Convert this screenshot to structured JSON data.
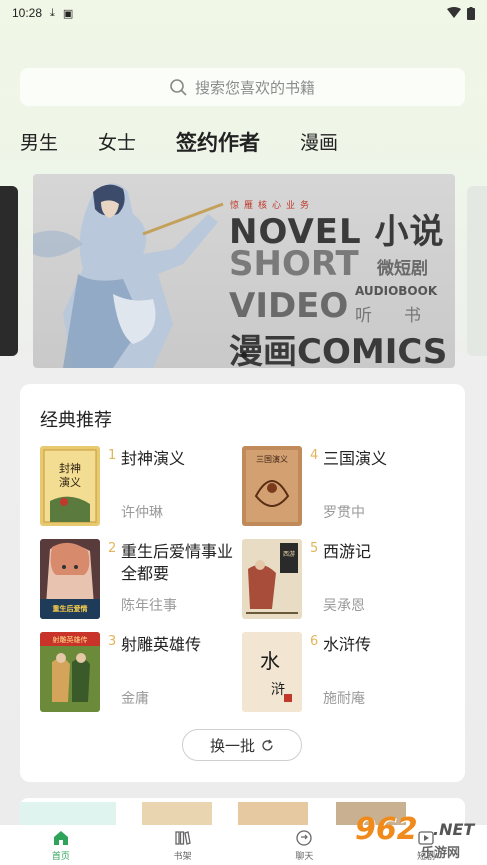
{
  "status_bar": {
    "time": "10:28"
  },
  "search": {
    "placeholder": "搜索您喜欢的书籍"
  },
  "tabs": [
    {
      "label": "男生",
      "active": false
    },
    {
      "label": "女士",
      "active": false
    },
    {
      "label": "签约作者",
      "active": true
    },
    {
      "label": "漫画",
      "active": false
    }
  ],
  "banner": {
    "tag": "惊雁核心业务",
    "line1": "NOVEL 小说",
    "line2": "SHORT",
    "line2_cn": "微短剧",
    "line3": "VIDEO",
    "line3_en": "AUDIOBOOK",
    "line3_cn": "听书",
    "line4": "漫画COMICS"
  },
  "section": {
    "title": "经典推荐",
    "books": [
      {
        "rank": "1",
        "title": "封神演义",
        "author": "许仲琳"
      },
      {
        "rank": "4",
        "title": "三国演义",
        "author": "罗贯中"
      },
      {
        "rank": "2",
        "title": "重生后爱情事业全都要",
        "author": "陈年往事"
      },
      {
        "rank": "5",
        "title": "西游记",
        "author": "吴承恩"
      },
      {
        "rank": "3",
        "title": "射雕英雄传",
        "author": "金庸"
      },
      {
        "rank": "6",
        "title": "水浒传",
        "author": "施耐庵"
      }
    ],
    "refresh_label": "换一批"
  },
  "tabbar": [
    {
      "label": "首页",
      "icon": "home-icon",
      "active": true
    },
    {
      "label": "书架",
      "icon": "bookshelf-icon",
      "active": false
    },
    {
      "label": "聊天",
      "icon": "chat-icon",
      "active": false
    },
    {
      "label": "短剧",
      "icon": "video-icon",
      "active": false
    }
  ],
  "watermark": {
    "big": "962",
    "net": ".NET",
    "sub": "乐游网"
  },
  "colors": {
    "accent": "#2fa35a",
    "rank": "#e2b55a",
    "watermark": "#f08a1a"
  }
}
